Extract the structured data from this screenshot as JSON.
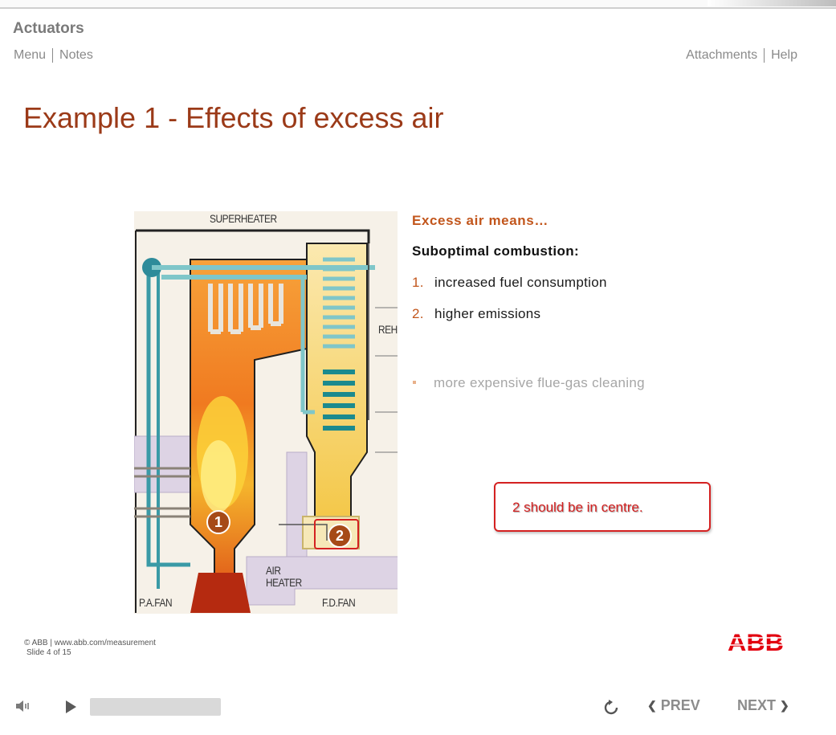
{
  "app": {
    "title": "Actuators"
  },
  "nav": {
    "menu": "Menu",
    "notes": "Notes",
    "attachments": "Attachments",
    "help": "Help"
  },
  "slide": {
    "title": "Example 1 - Effects of excess air",
    "heading": "Excess air means…",
    "subheading": "Suboptimal combustion:",
    "list": [
      {
        "num": "1.",
        "text": "increased fuel consumption"
      },
      {
        "num": "2.",
        "text": "higher emissions"
      }
    ],
    "bullet": "more expensive flue-gas cleaning"
  },
  "diagram": {
    "labels": {
      "superheater": "SUPERHEATER",
      "reheater_partial": "REH",
      "air_heater_line1": "AIR",
      "air_heater_line2": "HEATER",
      "pa_fan": "P.A.FAN",
      "fd_fan": "F.D.FAN"
    },
    "markers": [
      "1",
      "2"
    ]
  },
  "callout": {
    "text": "2 should be in centre."
  },
  "footer": {
    "copyright": "© ABB | www.abb.com/measurement",
    "slide": "Slide 4 of 15",
    "logo": "ABB"
  },
  "player": {
    "prev": "PREV",
    "next": "NEXT",
    "icons": {
      "volume": "speaker-icon",
      "play": "play-icon",
      "replay": "replay-icon"
    }
  },
  "colors": {
    "title": "#9b3a18",
    "accent": "#c2561c",
    "callout": "#d42121",
    "abb_red": "#e2000f"
  }
}
